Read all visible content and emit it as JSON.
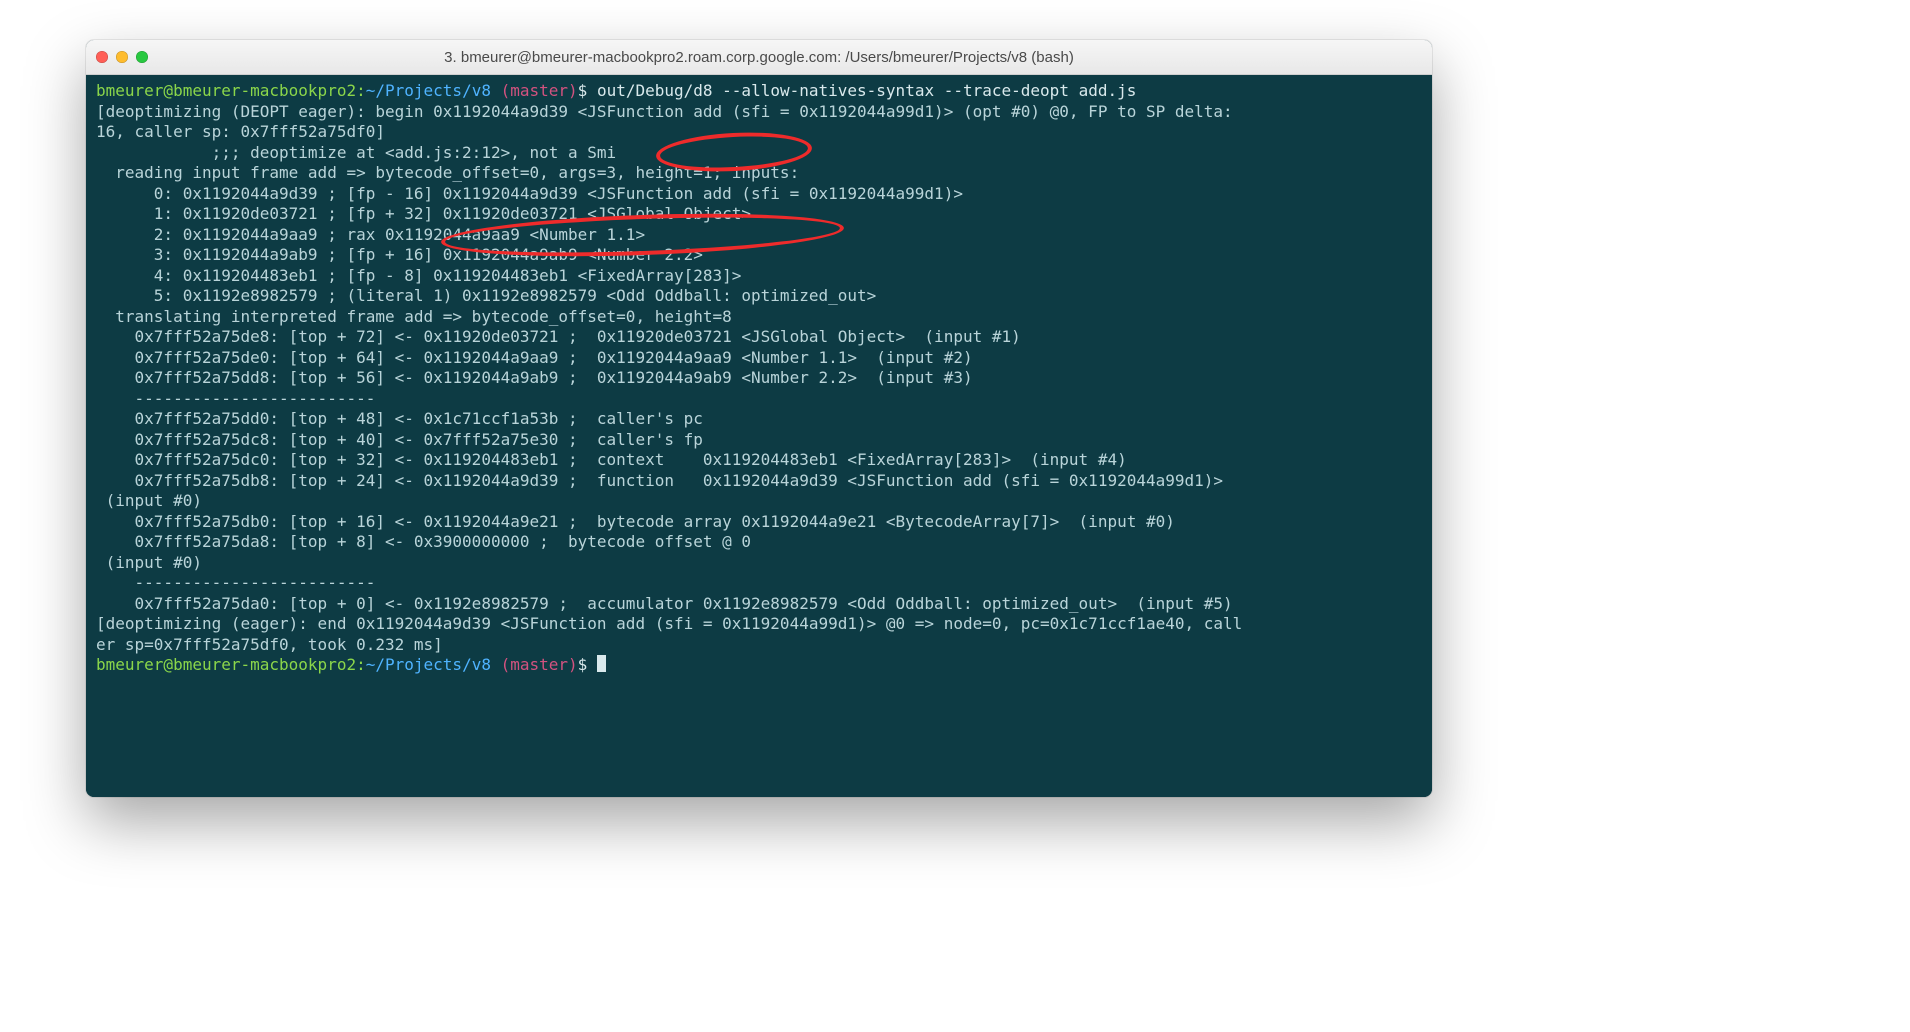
{
  "window": {
    "title": "3. bmeurer@bmeurer-macbookpro2.roam.corp.google.com: /Users/bmeurer/Projects/v8 (bash)"
  },
  "prompt": {
    "userhost": "bmeurer@bmeurer-macbookpro2",
    "sep": ":",
    "path": "~/Projects/v8",
    "branch": " (master)",
    "sigil": "$ "
  },
  "command": "out/Debug/d8 --allow-natives-syntax --trace-deopt add.js",
  "output_lines": [
    "[deoptimizing (DEOPT eager): begin 0x1192044a9d39 <JSFunction add (sfi = 0x1192044a99d1)> (opt #0) @0, FP to SP delta:",
    "16, caller sp: 0x7fff52a75df0]",
    "            ;;; deoptimize at <add.js:2:12>, not a Smi",
    "  reading input frame add => bytecode_offset=0, args=3, height=1; inputs:",
    "      0: 0x1192044a9d39 ; [fp - 16] 0x1192044a9d39 <JSFunction add (sfi = 0x1192044a99d1)>",
    "      1: 0x11920de03721 ; [fp + 32] 0x11920de03721 <JSGlobal Object>",
    "      2: 0x1192044a9aa9 ; rax 0x1192044a9aa9 <Number 1.1>",
    "      3: 0x1192044a9ab9 ; [fp + 16] 0x1192044a9ab9 <Number 2.2>",
    "      4: 0x119204483eb1 ; [fp - 8] 0x119204483eb1 <FixedArray[283]>",
    "      5: 0x1192e8982579 ; (literal 1) 0x1192e8982579 <Odd Oddball: optimized_out>",
    "  translating interpreted frame add => bytecode_offset=0, height=8",
    "    0x7fff52a75de8: [top + 72] <- 0x11920de03721 ;  0x11920de03721 <JSGlobal Object>  (input #1)",
    "    0x7fff52a75de0: [top + 64] <- 0x1192044a9aa9 ;  0x1192044a9aa9 <Number 1.1>  (input #2)",
    "    0x7fff52a75dd8: [top + 56] <- 0x1192044a9ab9 ;  0x1192044a9ab9 <Number 2.2>  (input #3)",
    "    -------------------------",
    "    0x7fff52a75dd0: [top + 48] <- 0x1c71ccf1a53b ;  caller's pc",
    "    0x7fff52a75dc8: [top + 40] <- 0x7fff52a75e30 ;  caller's fp",
    "    0x7fff52a75dc0: [top + 32] <- 0x119204483eb1 ;  context    0x119204483eb1 <FixedArray[283]>  (input #4)",
    "    0x7fff52a75db8: [top + 24] <- 0x1192044a9d39 ;  function   0x1192044a9d39 <JSFunction add (sfi = 0x1192044a99d1)>",
    " (input #0)",
    "    0x7fff52a75db0: [top + 16] <- 0x1192044a9e21 ;  bytecode array 0x1192044a9e21 <BytecodeArray[7]>  (input #0)",
    "    0x7fff52a75da8: [top + 8] <- 0x3900000000 ;  bytecode offset @ 0",
    " (input #0)",
    "    -------------------------",
    "    0x7fff52a75da0: [top + 0] <- 0x1192e8982579 ;  accumulator 0x1192e8982579 <Odd Oddball: optimized_out>  (input #5)",
    "[deoptimizing (eager): end 0x1192044a9d39 <JSFunction add (sfi = 0x1192044a99d1)> @0 => node=0, pc=0x1c71ccf1ae40, call",
    "er sp=0x7fff52a75df0, took 0.232 ms]"
  ],
  "annotations": [
    {
      "id": "not-a-smi-callout",
      "text": "not a Smi"
    },
    {
      "id": "rax-number-callout",
      "text": "rax 0x1192044a9aa9 <Number 1.1>"
    }
  ]
}
